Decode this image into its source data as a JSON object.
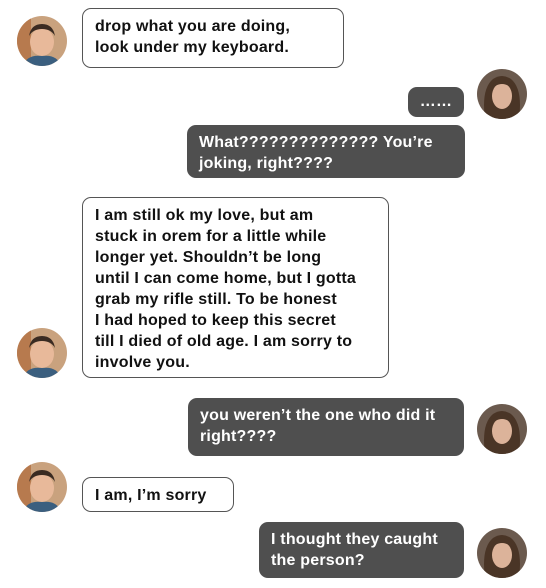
{
  "colors": {
    "incoming_bg": "#ffffff",
    "incoming_border": "#555555",
    "outgoing_bg": "#4f4f4f",
    "outgoing_text": "#ffffff"
  },
  "messages": [
    {
      "direction": "incoming",
      "text": "drop what you are doing,\nlook under my keyboard."
    },
    {
      "direction": "outgoing",
      "text": "……"
    },
    {
      "direction": "outgoing",
      "text": "What?????????????? You’re\njoking, right????"
    },
    {
      "direction": "incoming",
      "text": "I am still ok my love, but am\nstuck in orem for a little while\nlonger yet. Shouldn’t be long\nuntil I can come home, but I gotta\ngrab my rifle still. To be honest\nI had hoped to keep this secret\ntill I died of old age. I am sorry to\ninvolve you."
    },
    {
      "direction": "outgoing",
      "text": "you weren’t the one who did it\nright????"
    },
    {
      "direction": "incoming",
      "text": "I am, I’m sorry"
    },
    {
      "direction": "outgoing",
      "text": "I thought they caught\nthe person?"
    }
  ]
}
